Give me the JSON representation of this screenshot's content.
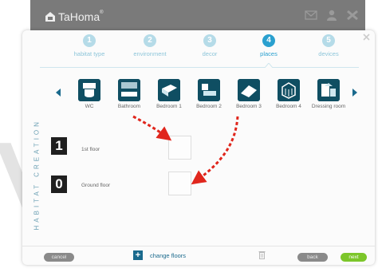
{
  "app": {
    "name": "TaHoma",
    "trademark": "®"
  },
  "watermark": "VARY",
  "steps": [
    {
      "num": "1",
      "label": "habitat type"
    },
    {
      "num": "2",
      "label": "environment"
    },
    {
      "num": "3",
      "label": "decor"
    },
    {
      "num": "4",
      "label": "places",
      "active": true
    },
    {
      "num": "5",
      "label": "devices"
    }
  ],
  "rooms": [
    "WC",
    "Bathroom",
    "Bedroom 1",
    "Bedroom 2",
    "Bedroom 3",
    "Bedroom 4",
    "Dressing room"
  ],
  "floors": [
    {
      "num": "1",
      "label": "1st floor"
    },
    {
      "num": "0",
      "label": "Ground floor"
    }
  ],
  "vertical_title": "HABITAT CREATION",
  "bottom": {
    "cancel": "cancel",
    "change_floors": "change floors",
    "back": "back",
    "next": "next"
  },
  "colors": {
    "accent": "#2aa0cf",
    "step_inactive": "#b5dbe8",
    "room_tile": "#0f4e62",
    "next_button": "#7cc62a",
    "drag_arrow": "#e0261c"
  }
}
